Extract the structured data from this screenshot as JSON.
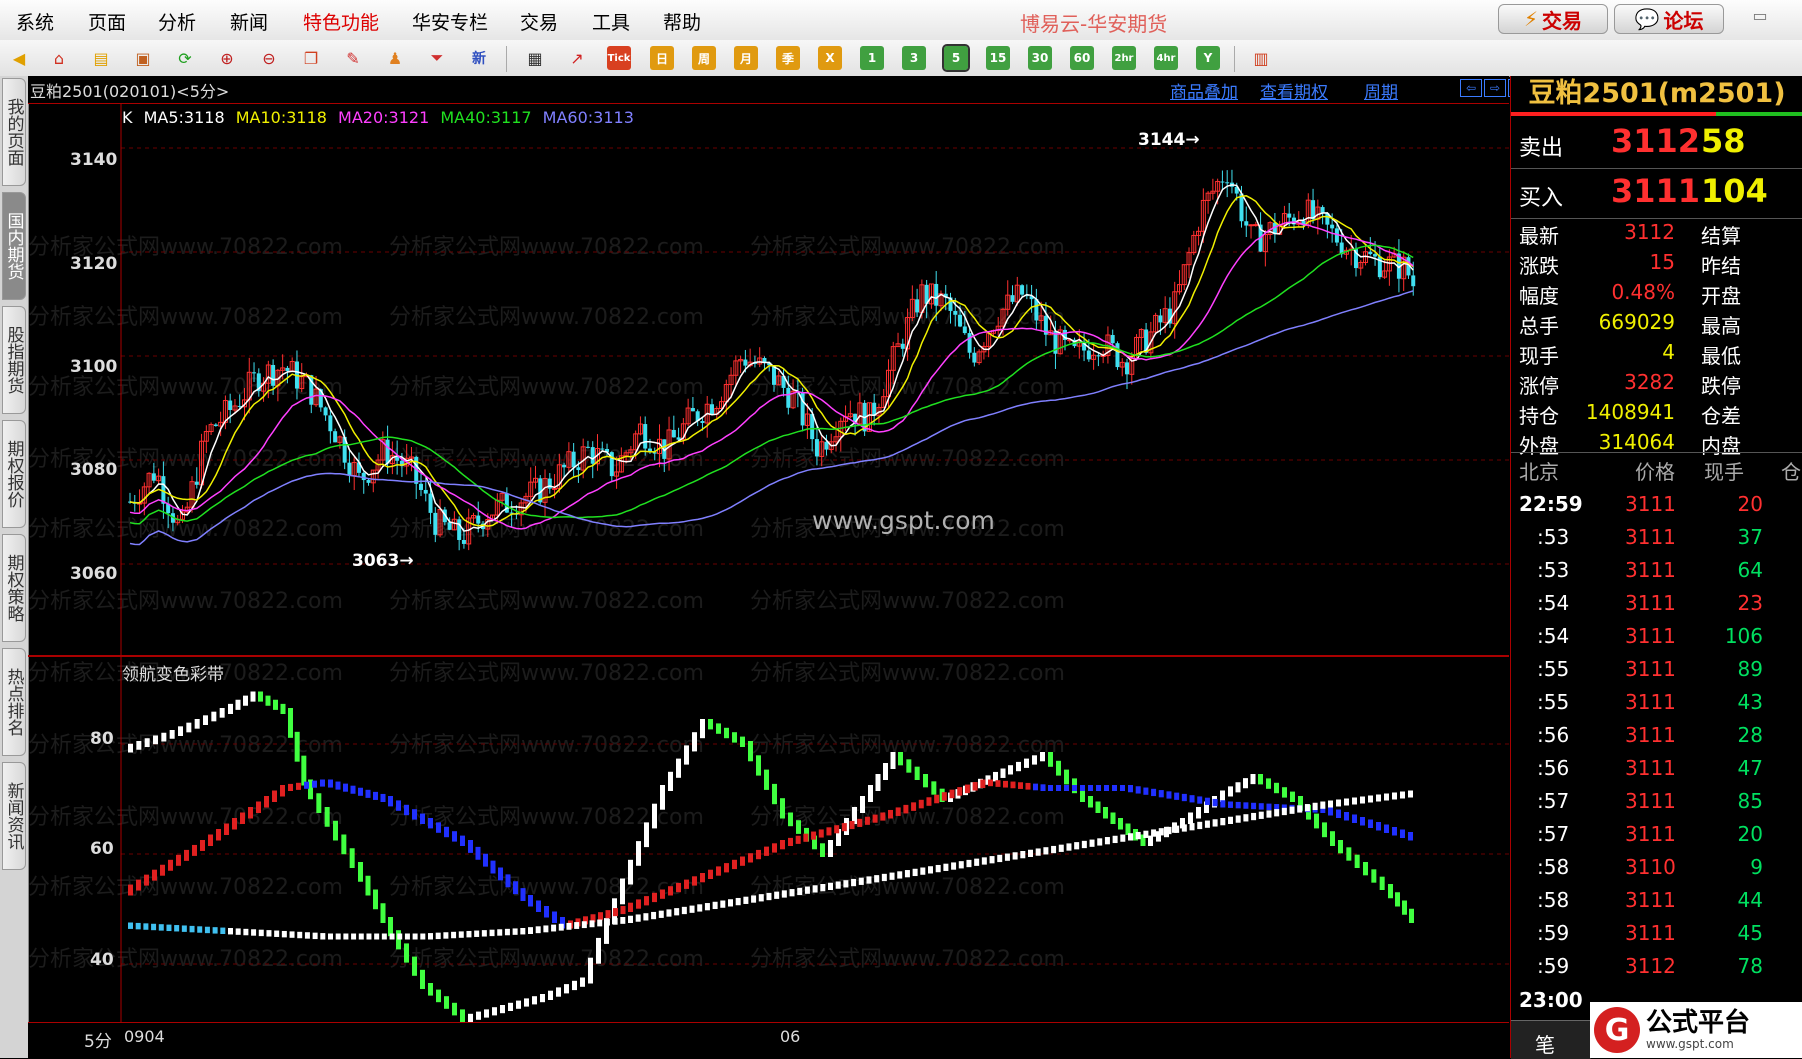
{
  "menu": {
    "items": [
      "系统",
      "页面",
      "分析",
      "新闻",
      "特色功能",
      "华安专栏",
      "交易",
      "工具",
      "帮助"
    ],
    "app_title": "博易云-华安期货",
    "trade_button": "交易",
    "forum_button": "论坛"
  },
  "toolbar": {
    "periods": [
      "Tick",
      "日",
      "周",
      "月",
      "季",
      "X",
      "1",
      "3",
      "5",
      "15",
      "30",
      "60",
      "2hr",
      "4hr",
      "Y"
    ],
    "news_icon_label": "新"
  },
  "left_tabs": [
    "我的页面",
    "国内期货",
    "股指期货",
    "期权报价",
    "期权策略",
    "热点排名",
    "新闻资讯"
  ],
  "chart_header": {
    "symbol_label": "豆粕2501(020101)<5分>",
    "link_overlay": "商品叠加",
    "link_options": "查看期权",
    "link_period": "周期"
  },
  "ma_legend": {
    "k": "K",
    "ma5": "MA5:3118",
    "ma10": "MA10:3118",
    "ma20": "MA20:3121",
    "ma40": "MA40:3117",
    "ma60": "MA60:3113",
    "colors": {
      "k": "#ffffff",
      "ma5": "#ffffff",
      "ma10": "#f0f000",
      "ma20": "#ff40ff",
      "ma40": "#20e020",
      "ma60": "#8080ff"
    }
  },
  "indicator_label": "领航变色彩带",
  "price_axis": [
    "3140",
    "3120",
    "3100",
    "3080",
    "3060"
  ],
  "indicator_axis": [
    "80",
    "60",
    "40"
  ],
  "annotations": {
    "high": "3144",
    "low": "3063"
  },
  "center_watermark": "www.gspt.com",
  "watermark_text": "分析家公式网www.70822.com",
  "bottom_axis": {
    "period": "5分",
    "date1": "0904",
    "date2": "06"
  },
  "quote_panel": {
    "title": "豆粕2501(m2501)",
    "sell_label": "卖出",
    "sell_price": "3112",
    "sell_vol": "58",
    "buy_label": "买入",
    "buy_price": "3111",
    "buy_vol": "104",
    "rows": [
      {
        "label": "最新",
        "value": "3112",
        "label2": "结算"
      },
      {
        "label": "涨跌",
        "value": "15",
        "label2": "昨结"
      },
      {
        "label": "幅度",
        "value": "0.48%",
        "label2": "开盘"
      },
      {
        "label": "总手",
        "value": "669029",
        "label2": "最高"
      },
      {
        "label": "现手",
        "value": "4",
        "label2": "最低"
      },
      {
        "label": "涨停",
        "value": "3282",
        "label2": "跌停"
      },
      {
        "label": "持仓",
        "value": "1408941",
        "label2": "仓差"
      },
      {
        "label": "外盘",
        "value": "314064",
        "label2": "内盘"
      }
    ],
    "tick_headers": [
      "北京",
      "价格",
      "现手",
      "仓"
    ],
    "ticks": [
      {
        "time": "22:59",
        "price": "3111",
        "vol": "20"
      },
      {
        "time": ":53",
        "price": "3111",
        "vol": "37"
      },
      {
        "time": ":53",
        "price": "3111",
        "vol": "64"
      },
      {
        "time": ":54",
        "price": "3111",
        "vol": "23"
      },
      {
        "time": ":54",
        "price": "3111",
        "vol": "106"
      },
      {
        "time": ":55",
        "price": "3111",
        "vol": "89"
      },
      {
        "time": ":55",
        "price": "3111",
        "vol": "43"
      },
      {
        "time": ":56",
        "price": "3111",
        "vol": "28"
      },
      {
        "time": ":56",
        "price": "3111",
        "vol": "47"
      },
      {
        "time": ":57",
        "price": "3111",
        "vol": "85"
      },
      {
        "time": ":57",
        "price": "3111",
        "vol": "20"
      },
      {
        "time": ":58",
        "price": "3110",
        "vol": "9"
      },
      {
        "time": ":58",
        "price": "3111",
        "vol": "44"
      },
      {
        "time": ":59",
        "price": "3111",
        "vol": "45"
      },
      {
        "time": ":59",
        "price": "3112",
        "vol": "78"
      }
    ],
    "next_time": "23:00",
    "bottom_tab": "笔"
  },
  "logo": {
    "main": "公式平台",
    "sub": "www.gspt.com"
  }
}
